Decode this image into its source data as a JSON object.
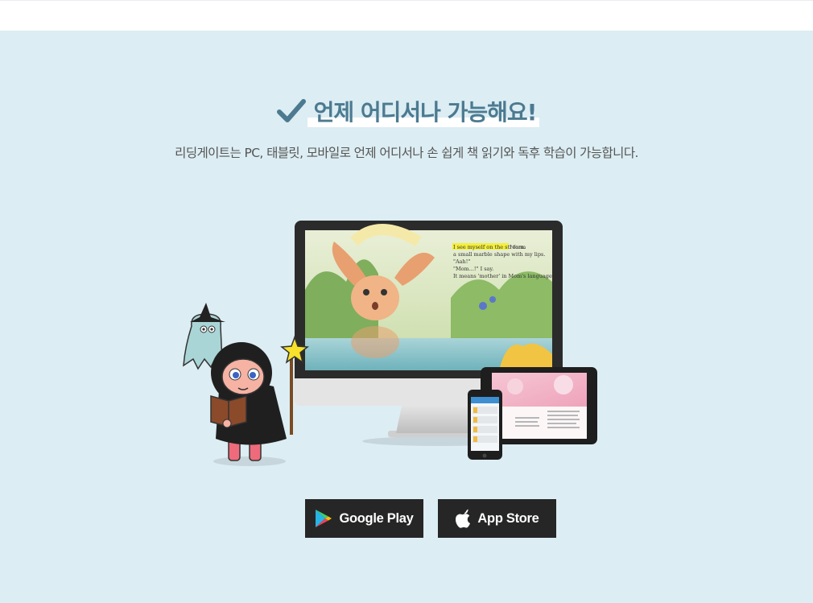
{
  "headline": {
    "title": "언제 어디서나 가능해요!"
  },
  "subtitle": "리딩게이트는 PC, 태블릿, 모바일로 언제 어디서나 손 쉽게 책 읽기와 독후 학습이 가능합니다.",
  "monitor_story": {
    "highlight": "I see myself on the stream.",
    "line1_rest": " I form",
    "line2": "a small marble shape with my lips.",
    "line3": "\"Aah!\"",
    "line4": "\"Mom...!\" I say.",
    "line5": "It means 'mother' in Mom's language."
  },
  "store_buttons": {
    "google": "Google Play",
    "apple": "App Store"
  },
  "colors": {
    "section_bg": "#dcedf3",
    "title": "#4c7a90",
    "button_bg": "#262626",
    "highlight": "#f5ef3b"
  }
}
